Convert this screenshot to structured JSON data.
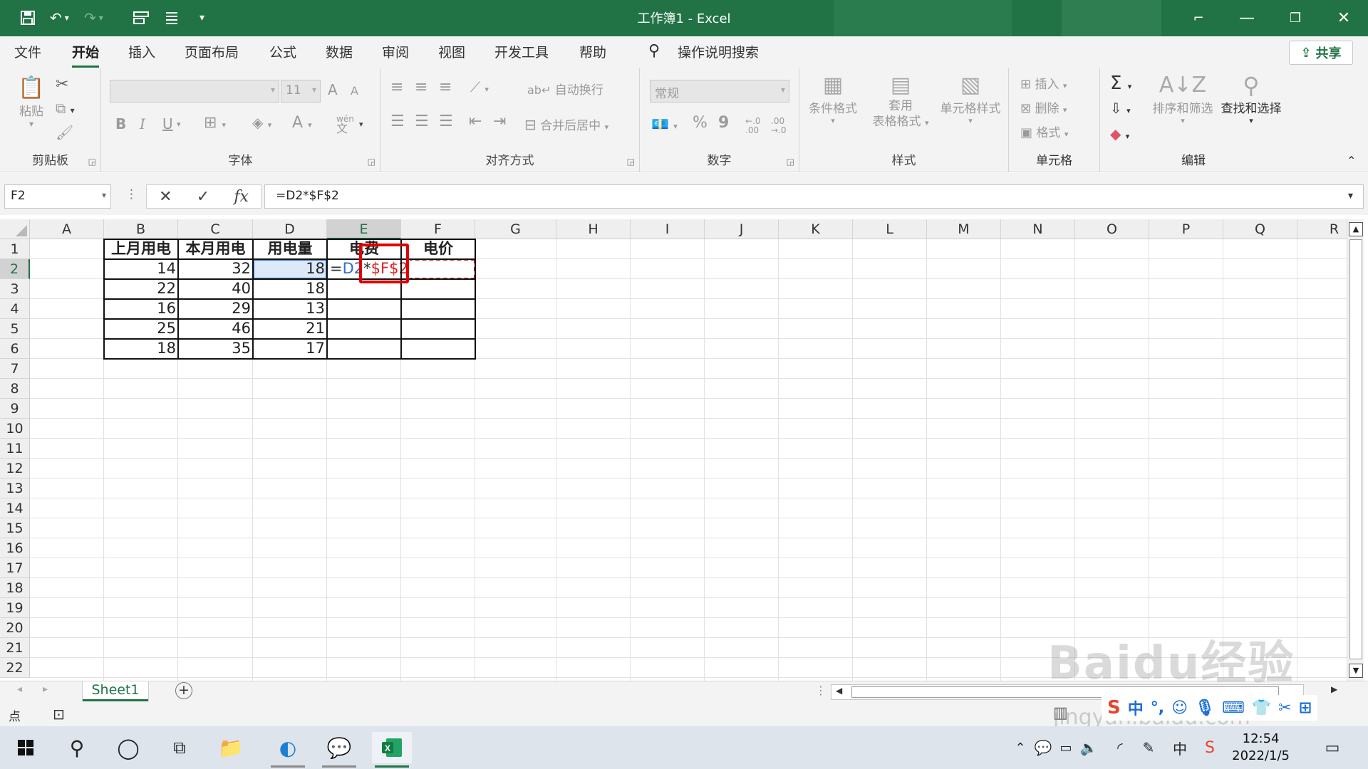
{
  "window": {
    "title": "工作簿1  -  Excel"
  },
  "quick_access": {
    "icons": [
      "save-icon",
      "undo-icon",
      "redo-icon",
      "touch-mode-icon",
      "form-icon",
      "customize-icon"
    ]
  },
  "menu": {
    "tabs": [
      "文件",
      "开始",
      "插入",
      "页面布局",
      "公式",
      "数据",
      "审阅",
      "视图",
      "开发工具",
      "帮助"
    ],
    "active": "开始",
    "search_label": "操作说明搜索",
    "share_label": "共享"
  },
  "ribbon": {
    "clipboard": {
      "label": "剪贴板",
      "paste": "粘贴"
    },
    "font": {
      "label": "字体",
      "size": "11",
      "bold": "B",
      "italic": "I",
      "underline": "U",
      "grow": "A",
      "shrink": "A",
      "font_color": "A",
      "phonetic": "wén"
    },
    "alignment": {
      "label": "对齐方式",
      "wrap": "自动换行",
      "merge": "合并后居中"
    },
    "number": {
      "label": "数字",
      "format": "常规",
      "percent": "%",
      "comma": "9",
      "inc_dec": ".00",
      "dec_dec": ".0"
    },
    "styles": {
      "label": "样式",
      "conditional": "条件格式",
      "table_1": "套用",
      "table_2": "表格格式",
      "cell_styles": "单元格样式"
    },
    "cells": {
      "label": "单元格",
      "insert": "插入",
      "delete": "删除",
      "format": "格式"
    },
    "editing": {
      "label": "编辑",
      "sort": "排序和筛选",
      "find": "查找和选择",
      "sigma": "Σ"
    }
  },
  "formula_bar": {
    "name_box": "F2",
    "cancel": "✕",
    "enter": "✓",
    "fx": "fx",
    "formula": "=D2*$F$2"
  },
  "grid": {
    "columns": [
      "A",
      "B",
      "C",
      "D",
      "E",
      "F",
      "G",
      "H",
      "I",
      "J",
      "K",
      "L",
      "M",
      "N",
      "O",
      "P",
      "Q",
      "R"
    ],
    "rows": [
      "1",
      "2",
      "3",
      "4",
      "5",
      "6",
      "7",
      "8",
      "9",
      "10",
      "11",
      "12",
      "13",
      "14",
      "15",
      "16",
      "17",
      "18",
      "19",
      "20",
      "21",
      "22"
    ],
    "headers": [
      "上月用电",
      "本月用电",
      "用电量",
      "电费",
      "电价"
    ],
    "data": [
      [
        "14",
        "32",
        "18"
      ],
      [
        "22",
        "40",
        "18"
      ],
      [
        "16",
        "29",
        "13"
      ],
      [
        "25",
        "46",
        "21"
      ],
      [
        "18",
        "35",
        "17"
      ]
    ],
    "editing_cell": {
      "eq": "=",
      "ref": "D2",
      "op": "*",
      "abs": "$F$2"
    }
  },
  "sheets": {
    "tabs": [
      "Sheet1"
    ],
    "add": "+"
  },
  "status": {
    "mode": "点"
  },
  "taskbar": {
    "icons": [
      "windows-icon",
      "search-icon",
      "cortana-icon",
      "task-view-icon",
      "file-explorer-icon",
      "edge-icon",
      "wechat-icon",
      "excel-icon"
    ],
    "time": "12:54",
    "date": "2022/1/5",
    "ime": "中"
  },
  "watermark": {
    "logo": "Baidu经验",
    "url": "jingyan.baidu.com"
  },
  "colors": {
    "excel_green": "#217346",
    "ref_blue": "#2f6fd0",
    "ref_red": "#e02020",
    "highlight_box": "#e00000"
  }
}
